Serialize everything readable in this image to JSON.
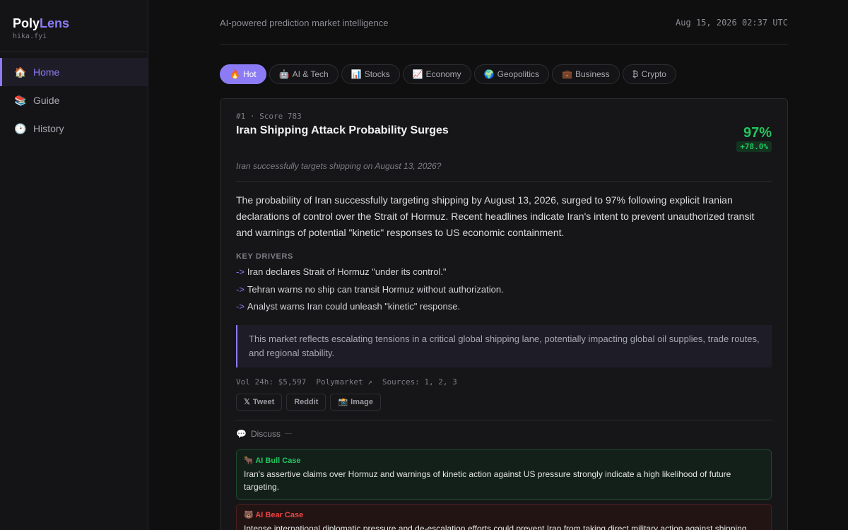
{
  "brand": {
    "poly": "Poly",
    "lens": "Lens",
    "domain": "hika.fyi"
  },
  "sidebar": {
    "items": [
      {
        "icon": "🏠",
        "icon_name": "home-icon",
        "label": "Home",
        "active": true
      },
      {
        "icon": "📚",
        "icon_name": "books-icon",
        "label": "Guide",
        "active": false
      },
      {
        "icon": "🕑",
        "icon_name": "clock-icon",
        "label": "History",
        "active": false
      }
    ]
  },
  "header": {
    "tagline": "AI-powered prediction market intelligence",
    "timestamp": "Aug 15, 2026 02:37 UTC"
  },
  "tabs": [
    {
      "icon": "🔥",
      "label": "Hot",
      "active": true
    },
    {
      "icon": "🤖",
      "label": "AI & Tech",
      "active": false
    },
    {
      "icon": "📊",
      "label": "Stocks",
      "active": false
    },
    {
      "icon": "📈",
      "label": "Economy",
      "active": false
    },
    {
      "icon": "🌍",
      "label": "Geopolitics",
      "active": false
    },
    {
      "icon": "💼",
      "label": "Business",
      "active": false
    },
    {
      "icon": "₿",
      "label": "Crypto",
      "active": false
    }
  ],
  "card": {
    "rank_line": "#1 · Score 783",
    "title": "Iran Shipping Attack Probability Surges",
    "probability": "97%",
    "delta": "+78.0%",
    "question": "Iran successfully targets shipping on August 13, 2026?",
    "summary": "The probability of Iran successfully targeting shipping by August 13, 2026, surged to 97% following explicit Iranian declarations of control over the Strait of Hormuz. Recent headlines indicate Iran's intent to prevent unauthorized transit and warnings of potential \"kinetic\" responses to US economic containment.",
    "drivers_label": "KEY DRIVERS",
    "drivers": [
      "Iran declares Strait of Hormuz \"under its control.\"",
      "Tehran warns no ship can transit Hormuz without authorization.",
      "Analyst warns Iran could unleash \"kinetic\" response."
    ],
    "driver_arrow": "->",
    "quote": "This market reflects escalating tensions in a critical global shipping lane, potentially impacting global oil supplies, trade routes, and regional stability.",
    "meta": {
      "volume": "Vol 24h: $5,597",
      "source_link": "Polymarket ↗",
      "sources": "Sources: 1, 2, 3"
    },
    "actions": [
      {
        "icon": "𝕏",
        "label": "Tweet"
      },
      {
        "icon": "",
        "label": "Reddit"
      },
      {
        "icon": "📸",
        "label": "Image"
      }
    ],
    "discuss": {
      "icon": "💬",
      "label": "Discuss"
    },
    "bull": {
      "icon": "🐂",
      "title": "AI Bull Case",
      "text": "Iran's assertive claims over Hormuz and warnings of kinetic action against US pressure strongly indicate a high likelihood of future targeting."
    },
    "bear": {
      "icon": "🐻",
      "title": "AI Bear Case",
      "text": "Intense international diplomatic pressure and de-escalation efforts could prevent Iran from taking direct military action against shipping."
    }
  },
  "colors": {
    "accent": "#8b7cf6",
    "positive": "#22c55e",
    "negative": "#ef4444",
    "background": "#0f0f10"
  }
}
